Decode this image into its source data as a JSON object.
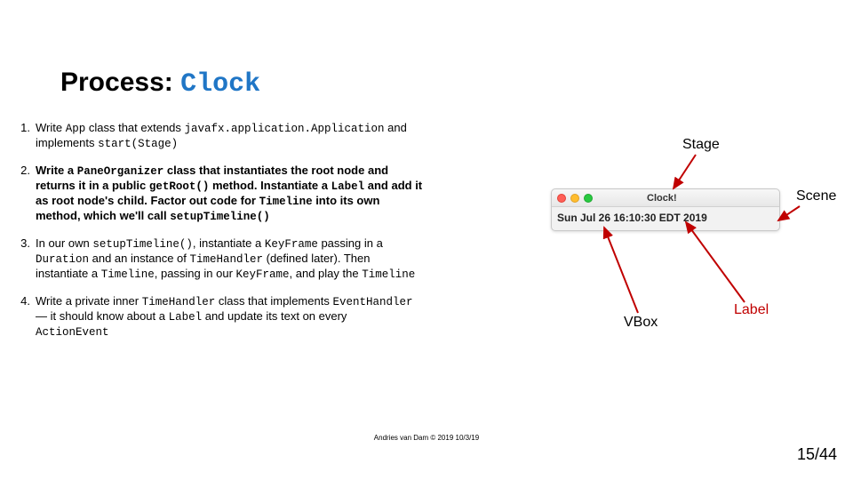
{
  "title": {
    "pre": "Process: ",
    "code": "Clock"
  },
  "items": [
    {
      "num": "1.",
      "bold": false,
      "parts": [
        {
          "t": "Write ",
          "c": false
        },
        {
          "t": "App",
          "c": true
        },
        {
          "t": " class that extends ",
          "c": false
        },
        {
          "t": "javafx.application.Application",
          "c": true
        },
        {
          "t": " and implements ",
          "c": false
        },
        {
          "t": "start(Stage)",
          "c": true
        }
      ]
    },
    {
      "num": "2.",
      "bold": true,
      "parts": [
        {
          "t": "Write a ",
          "c": false
        },
        {
          "t": "PaneOrganizer",
          "c": true
        },
        {
          "t": " class that instantiates the root node and returns it in a public ",
          "c": false
        },
        {
          "t": "getRoot()",
          "c": true
        },
        {
          "t": " method. Instantiate a ",
          "c": false
        },
        {
          "t": "Label",
          "c": true
        },
        {
          "t": " and add it as root node's child. Factor out code for ",
          "c": false
        },
        {
          "t": "Timeline",
          "c": true
        },
        {
          "t": " into its own method, which we'll call ",
          "c": false
        },
        {
          "t": "setupTimeline()",
          "c": true
        }
      ]
    },
    {
      "num": "3.",
      "bold": false,
      "parts": [
        {
          "t": "In our own ",
          "c": false
        },
        {
          "t": "setupTimeline()",
          "c": true
        },
        {
          "t": ", instantiate a ",
          "c": false
        },
        {
          "t": "KeyFrame",
          "c": true
        },
        {
          "t": " passing in a ",
          "c": false
        },
        {
          "t": "Duration",
          "c": true
        },
        {
          "t": " and an instance of ",
          "c": false
        },
        {
          "t": "TimeHandler",
          "c": true
        },
        {
          "t": " (defined later). Then instantiate a ",
          "c": false
        },
        {
          "t": "Timeline",
          "c": true
        },
        {
          "t": ", passing in our ",
          "c": false
        },
        {
          "t": "KeyFrame",
          "c": true
        },
        {
          "t": ", and play the ",
          "c": false
        },
        {
          "t": "Timeline",
          "c": true
        }
      ]
    },
    {
      "num": "4.",
      "bold": false,
      "parts": [
        {
          "t": "Write a private inner ",
          "c": false
        },
        {
          "t": "TimeHandler",
          "c": true
        },
        {
          "t": " class that implements ",
          "c": false
        },
        {
          "t": "EventHandler",
          "c": true
        },
        {
          "t": " — it should know about a ",
          "c": false
        },
        {
          "t": "Label",
          "c": true
        },
        {
          "t": " and update its text on every ",
          "c": false
        },
        {
          "t": "ActionEvent",
          "c": true
        }
      ]
    }
  ],
  "diagram": {
    "stage": "Stage",
    "scene": "Scene",
    "vbox": "VBox",
    "label": "Label",
    "window_title": "Clock!",
    "clock_text": "Sun Jul 26 16:10:30 EDT 2019"
  },
  "footer": "Andries van Dam © 2019 10/3/19",
  "pagenum": "15/44"
}
